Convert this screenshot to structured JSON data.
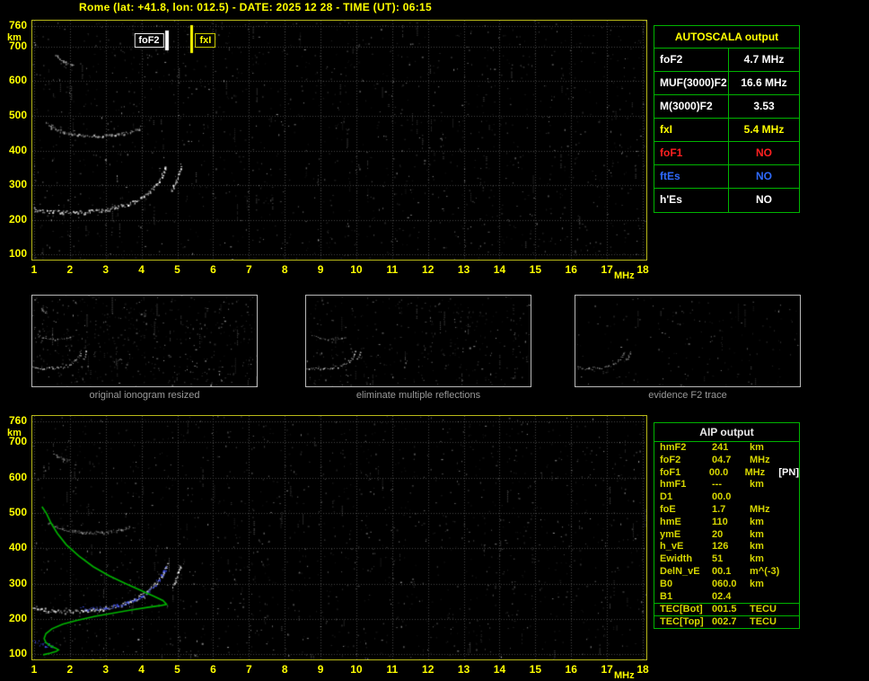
{
  "title": "Rome (lat: +41.8, lon: 012.5) - DATE: 2025 12 28 - TIME (UT): 06:15",
  "theme": {
    "background": "#000000",
    "title_color": "#ffff00",
    "axis_color": "#ffff00",
    "plot_border": "#b8b818",
    "table_border": "#00b400",
    "caption_color": "#9a9a9a"
  },
  "autoscala_table": {
    "header": "AUTOSCALA output",
    "rows": [
      {
        "param": "foF2",
        "value": "4.7 MHz",
        "color": "#ffffff"
      },
      {
        "param": "MUF(3000)F2",
        "value": "16.6 MHz",
        "color": "#ffffff"
      },
      {
        "param": "M(3000)F2",
        "value": "3.53",
        "color": "#ffffff"
      },
      {
        "param": "fxI",
        "value": "5.4 MHz",
        "color": "#ffff00"
      },
      {
        "param": "foF1",
        "value": "NO",
        "color": "#ff2020"
      },
      {
        "param": "ftEs",
        "value": "NO",
        "color": "#2f6bff"
      },
      {
        "param": "h'Es",
        "value": "NO",
        "color": "#ffffff"
      }
    ]
  },
  "thumbnails": [
    {
      "caption": "original ionogram resized",
      "noise": 520,
      "streaks": 30,
      "seed": 3,
      "series": [
        "F-trace",
        "F-cusp",
        "second-reflection",
        "high-blob"
      ],
      "alpha": 1
    },
    {
      "caption": "eliminate multiple reflections",
      "noise": 360,
      "streaks": 20,
      "seed": 17,
      "series": [
        "F-trace",
        "F-cusp",
        "second-reflection"
      ],
      "alpha": 0.9
    },
    {
      "caption": "evidence F2 trace",
      "noise": 170,
      "streaks": 12,
      "seed": 41,
      "series": [
        "F-trace",
        "F-cusp"
      ],
      "alpha": 0.7
    }
  ],
  "aip_table": {
    "header": "AIP output",
    "rows": [
      {
        "param": "hmF2",
        "value": "241",
        "unit": "km",
        "note": ""
      },
      {
        "param": "foF2",
        "value": "04.7",
        "unit": "MHz",
        "note": ""
      },
      {
        "param": "foF1",
        "value": "00.0",
        "unit": "MHz",
        "note": "[PN]"
      },
      {
        "param": "hmF1",
        "value": "---",
        "unit": "km",
        "note": ""
      },
      {
        "param": "D1",
        "value": "00.0",
        "unit": "",
        "note": ""
      },
      {
        "param": "foE",
        "value": "1.7",
        "unit": "MHz",
        "note": ""
      },
      {
        "param": "hmE",
        "value": "110",
        "unit": "km",
        "note": ""
      },
      {
        "param": "ymE",
        "value": "20",
        "unit": "km",
        "note": ""
      },
      {
        "param": "h_vE",
        "value": "126",
        "unit": "km",
        "note": ""
      },
      {
        "param": "Ewidth",
        "value": "51",
        "unit": "km",
        "note": ""
      },
      {
        "param": "DelN_vE",
        "value": "00.1",
        "unit": "m^(-3)",
        "note": ""
      },
      {
        "param": "B0",
        "value": "060.0",
        "unit": "km",
        "note": ""
      },
      {
        "param": "B1",
        "value": "02.4",
        "unit": "",
        "note": ""
      },
      {
        "param": "TEC[Bot]",
        "value": "001.5",
        "unit": "TECU",
        "note": "",
        "divider": true
      },
      {
        "param": "TEC[Top]",
        "value": "002.7",
        "unit": "TECU",
        "note": "",
        "divider": true
      }
    ]
  },
  "chart_data": [
    {
      "type": "scatter",
      "title": "ionogram with autoscaled characteristics",
      "xlabel": "MHz",
      "ylabel": "km",
      "xlim": [
        1,
        18
      ],
      "ylim": [
        100,
        760
      ],
      "grid": true,
      "x_ticks": [
        1,
        2,
        3,
        4,
        5,
        6,
        7,
        8,
        9,
        10,
        11,
        12,
        13,
        14,
        15,
        16,
        17,
        18
      ],
      "y_ticks": [
        760,
        700,
        600,
        500,
        400,
        300,
        200,
        100
      ],
      "markers": [
        {
          "label": "foF2",
          "freq": 4.7,
          "color": "#ffffff"
        },
        {
          "label": "fxI",
          "freq": 5.4,
          "color": "#ffff00"
        }
      ],
      "series": [
        {
          "name": "F-trace",
          "color": "#ffffff",
          "thickness": 3,
          "alpha": 1,
          "points": [
            [
              0.98,
              230
            ],
            [
              1.2,
              227
            ],
            [
              1.5,
              224
            ],
            [
              1.8,
              222
            ],
            [
              2.1,
              222
            ],
            [
              2.4,
              223
            ],
            [
              2.7,
              226
            ],
            [
              3.0,
              230
            ],
            [
              3.25,
              235
            ],
            [
              3.5,
              242
            ],
            [
              3.75,
              251
            ],
            [
              3.95,
              262
            ],
            [
              4.15,
              275
            ],
            [
              4.3,
              290
            ],
            [
              4.45,
              308
            ],
            [
              4.55,
              325
            ],
            [
              4.63,
              342
            ],
            [
              4.68,
              358
            ]
          ]
        },
        {
          "name": "F-cusp",
          "color": "#ffffff",
          "thickness": 3,
          "alpha": 1,
          "points": [
            [
              4.82,
              285
            ],
            [
              4.92,
              305
            ],
            [
              5.0,
              325
            ],
            [
              5.06,
              345
            ],
            [
              5.1,
              362
            ]
          ]
        },
        {
          "name": "second-reflection",
          "color": "#e0e0e0",
          "thickness": 2,
          "alpha": 0.75,
          "points": [
            [
              1.35,
              480
            ],
            [
              1.55,
              465
            ],
            [
              1.8,
              455
            ],
            [
              2.1,
              448
            ],
            [
              2.45,
              444
            ],
            [
              2.8,
              443
            ],
            [
              3.15,
              445
            ],
            [
              3.5,
              450
            ],
            [
              3.8,
              458
            ],
            [
              4.0,
              470
            ]
          ]
        },
        {
          "name": "high-blob",
          "color": "#d8d8d8",
          "thickness": 2,
          "alpha": 0.8,
          "points": [
            [
              1.6,
              675
            ],
            [
              1.7,
              665
            ],
            [
              1.8,
              657
            ],
            [
              1.95,
              650
            ],
            [
              2.1,
              646
            ]
          ]
        }
      ],
      "noise": {
        "seed": 11,
        "count": 1500,
        "streaks": 90
      }
    },
    {
      "type": "scatter",
      "title": "ionogram with restored trace and electron density profile",
      "xlabel": "MHz",
      "ylabel": "km",
      "xlim": [
        1,
        18
      ],
      "ylim": [
        100,
        760
      ],
      "grid": true,
      "x_ticks": [
        1,
        2,
        3,
        4,
        5,
        6,
        7,
        8,
        9,
        10,
        11,
        12,
        13,
        14,
        15,
        16,
        17,
        18
      ],
      "y_ticks": [
        760,
        700,
        600,
        500,
        400,
        300,
        200,
        100
      ],
      "markers": [],
      "series": [
        {
          "name": "F-trace",
          "color": "#ffffff",
          "thickness": 3,
          "alpha": 1,
          "points": [
            [
              0.98,
              232
            ],
            [
              1.3,
              227
            ],
            [
              1.6,
              223
            ],
            [
              1.9,
              221
            ],
            [
              2.2,
              222
            ],
            [
              2.5,
              224
            ],
            [
              2.8,
              228
            ],
            [
              3.1,
              233
            ],
            [
              3.4,
              240
            ],
            [
              3.65,
              249
            ],
            [
              3.9,
              260
            ],
            [
              4.1,
              273
            ],
            [
              4.3,
              290
            ],
            [
              4.45,
              307
            ],
            [
              4.57,
              325
            ],
            [
              4.65,
              343
            ],
            [
              4.7,
              358
            ]
          ]
        },
        {
          "name": "F-cusp",
          "color": "#ffffff",
          "thickness": 3,
          "alpha": 1,
          "points": [
            [
              4.85,
              290
            ],
            [
              4.95,
              312
            ],
            [
              5.03,
              334
            ],
            [
              5.08,
              355
            ]
          ]
        },
        {
          "name": "second-reflection",
          "color": "#c8c8c8",
          "thickness": 2,
          "alpha": 0.6,
          "points": [
            [
              1.4,
              472
            ],
            [
              1.7,
              458
            ],
            [
              2.0,
              450
            ],
            [
              2.35,
              445
            ],
            [
              2.7,
              444
            ],
            [
              3.05,
              447
            ],
            [
              3.4,
              453
            ],
            [
              3.7,
              462
            ]
          ]
        },
        {
          "name": "high-blob",
          "color": "#c8c8c8",
          "thickness": 2,
          "alpha": 0.6,
          "points": [
            [
              1.55,
              668
            ],
            [
              1.7,
              660
            ],
            [
              1.85,
              653
            ],
            [
              2.0,
              648
            ]
          ]
        },
        {
          "name": "restored-trace",
          "color": "#4356ff",
          "thickness": 3,
          "alpha": 1,
          "points": [
            [
              2.3,
              231
            ],
            [
              2.6,
              229
            ],
            [
              2.9,
              231
            ],
            [
              3.2,
              236
            ],
            [
              3.5,
              243
            ],
            [
              3.75,
              252
            ],
            [
              3.95,
              263
            ],
            [
              4.15,
              276
            ],
            [
              4.3,
              291
            ],
            [
              4.45,
              308
            ],
            [
              4.55,
              323
            ],
            [
              4.63,
              338
            ],
            [
              4.68,
              352
            ]
          ]
        },
        {
          "name": "Es-restored",
          "color": "#4356ff",
          "thickness": 4,
          "alpha": 1,
          "points": [
            [
              0.98,
              136
            ],
            [
              1.15,
              131
            ],
            [
              1.35,
              127
            ],
            [
              1.55,
              124
            ]
          ]
        },
        {
          "name": "electron-density-profile",
          "color": "#00b400",
          "style": "line",
          "points": [
            [
              1.25,
              98
            ],
            [
              1.45,
              103
            ],
            [
              1.62,
              108
            ],
            [
              1.68,
              112
            ],
            [
              1.6,
              117
            ],
            [
              1.45,
              124
            ],
            [
              1.33,
              133
            ],
            [
              1.28,
              144
            ],
            [
              1.33,
              158
            ],
            [
              1.5,
              172
            ],
            [
              1.8,
              185
            ],
            [
              2.2,
              196
            ],
            [
              2.7,
              207
            ],
            [
              3.2,
              216
            ],
            [
              3.7,
              225
            ],
            [
              4.2,
              233
            ],
            [
              4.55,
              238
            ],
            [
              4.7,
              241
            ],
            [
              4.6,
              252
            ],
            [
              4.35,
              264
            ],
            [
              4.0,
              280
            ],
            [
              3.55,
              300
            ],
            [
              3.1,
              322
            ],
            [
              2.65,
              348
            ],
            [
              2.25,
              378
            ],
            [
              1.9,
              410
            ],
            [
              1.65,
              442
            ],
            [
              1.47,
              472
            ],
            [
              1.35,
              498
            ],
            [
              1.22,
              518
            ]
          ]
        }
      ],
      "noise": {
        "seed": 29,
        "count": 1500,
        "streaks": 90
      }
    }
  ]
}
